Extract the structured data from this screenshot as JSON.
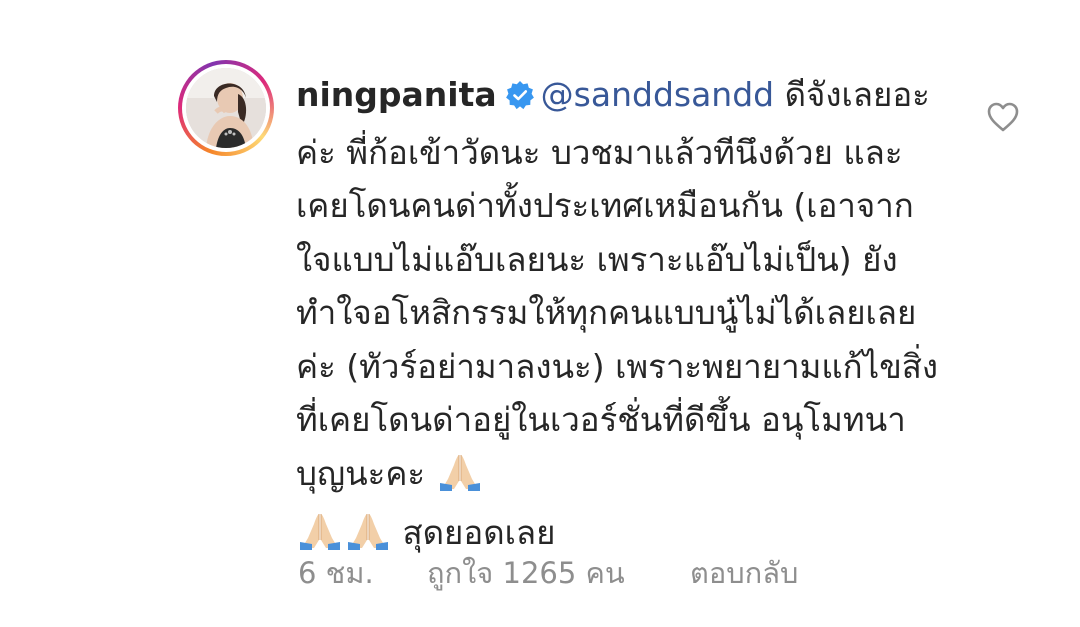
{
  "comment": {
    "username": "ningpanita",
    "verified": true,
    "mention": "@sanddsandd",
    "text": " ดีจังเลยอะค่ะ พี่ก้อเข้าวัดนะ บวชมาแล้วทีนึงด้วย และเคยโดนคนด่าทั้งประเทศเหมือนกัน (เอาจากใจแบบไม่แอ๊บเลยนะ เพราะแอ๊บไม่เป็น) ยังทำใจอโหสิกรรมให้ทุกคนแบบนู๋ไม่ได้เลยเลยค่ะ (ทัวร์อย่ามาลงนะ) เพราะพยายามแก้ไขสิ่งที่เคยโดนด่าอยู่ในเวอร์ชั่นที่ดีขึ้น อนุโมทนาบุญนะคะ ",
    "text_end": " สุดยอดเลย",
    "emoji_icon": "folded-hands-emoji"
  },
  "meta": {
    "time": "6 ชม.",
    "likes": "ถูกใจ 1265 คน",
    "reply": "ตอบกลับ"
  },
  "icons": {
    "like": "heart-outline-icon",
    "verified": "verified-badge-icon"
  },
  "colors": {
    "mention": "#385898",
    "meta": "#8e8e8e",
    "verified": "#3897f0"
  }
}
